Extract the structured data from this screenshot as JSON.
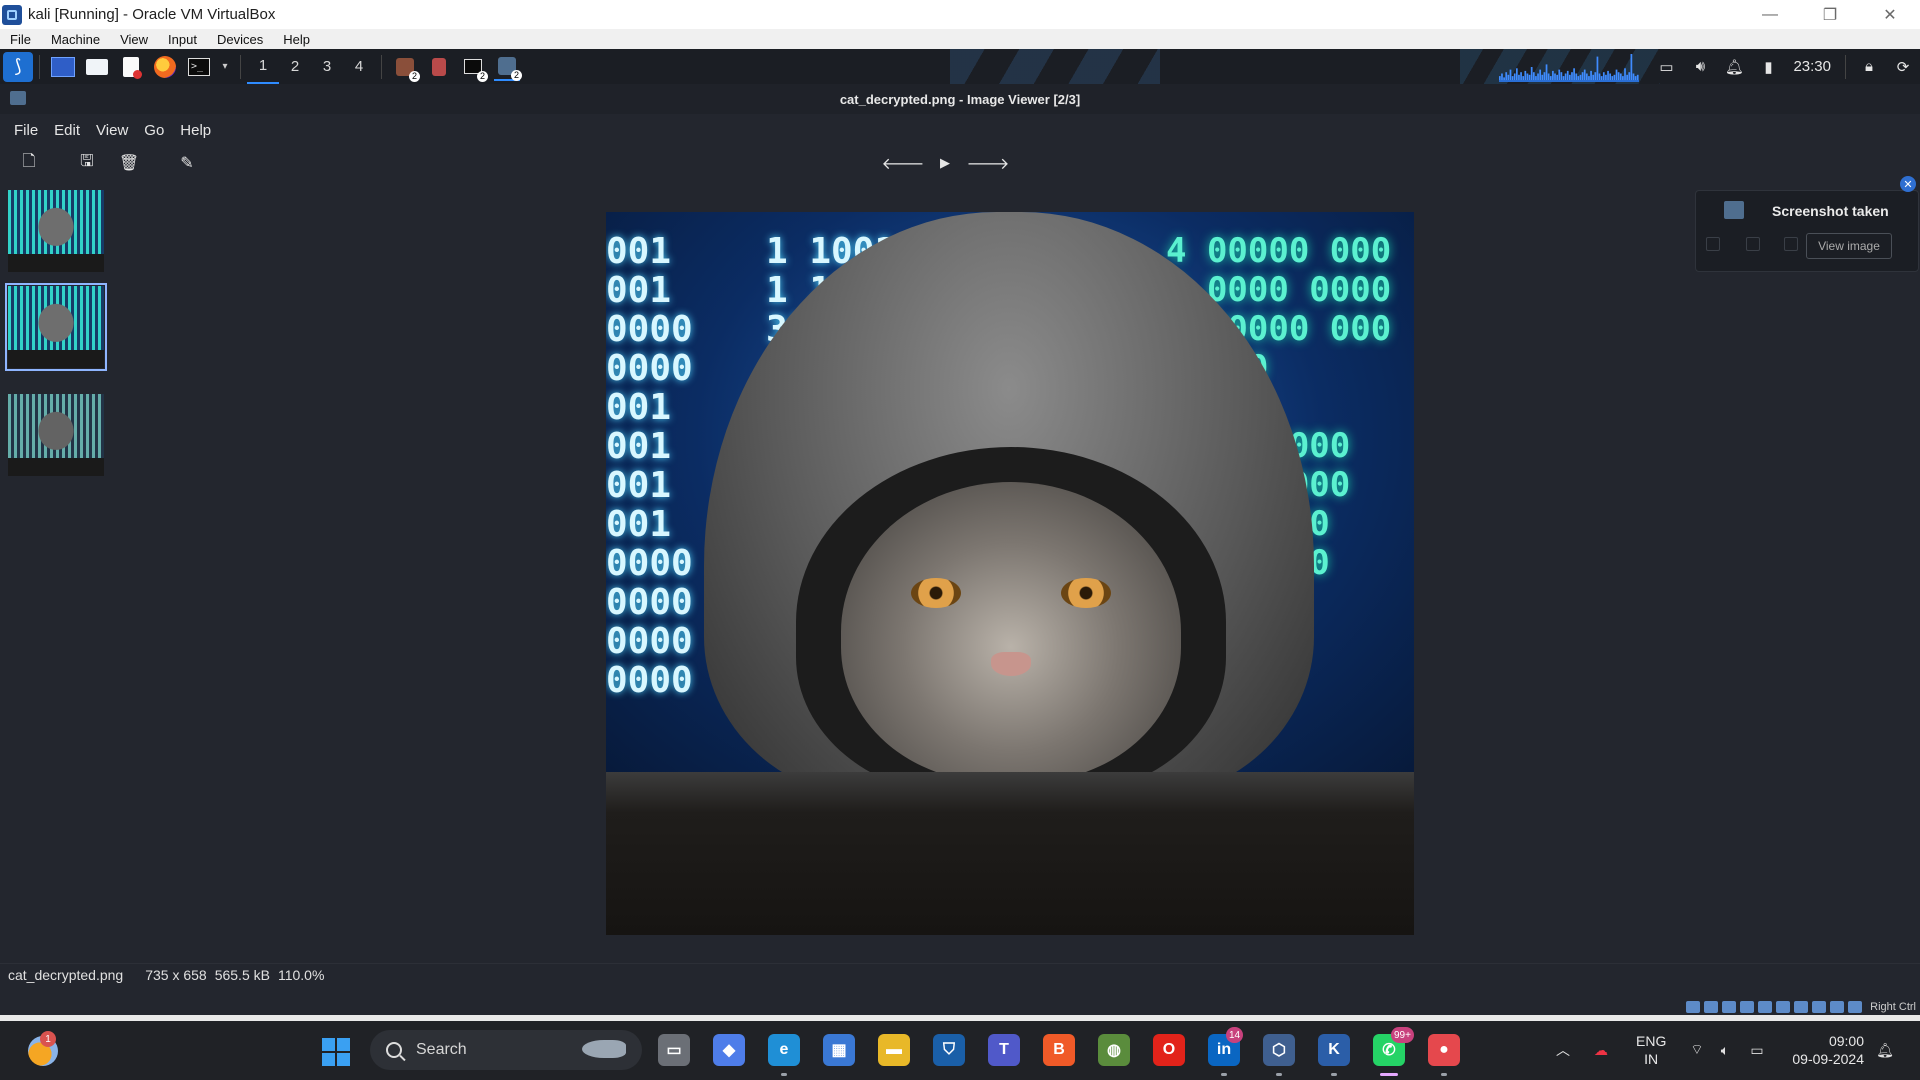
{
  "host_window": {
    "title": "kali [Running] - Oracle VM VirtualBox",
    "controls": {
      "minimize": "—",
      "restore": "❐",
      "close": "✕"
    }
  },
  "vbox_menu": [
    "File",
    "Machine",
    "View",
    "Input",
    "Devices",
    "Help"
  ],
  "kali_panel": {
    "workspaces": [
      "1",
      "2",
      "3",
      "4"
    ],
    "active_workspace": "1",
    "task_badges": [
      "2",
      "2",
      "2"
    ],
    "clock": "23:30",
    "terminal_glyph": ">_",
    "cpu_graph": [
      3,
      5,
      2,
      6,
      4,
      8,
      3,
      5,
      9,
      4,
      6,
      3,
      7,
      5,
      4,
      10,
      6,
      3,
      5,
      8,
      4,
      6,
      12,
      5,
      3,
      7,
      5,
      4,
      8,
      6,
      3,
      5,
      7,
      4,
      6,
      9,
      5,
      3,
      4,
      6,
      8,
      5,
      3,
      7,
      4,
      6,
      18,
      5,
      3,
      6,
      4,
      7,
      5,
      3,
      4,
      8,
      6,
      5,
      3,
      9,
      4,
      6,
      20,
      5,
      3,
      4
    ]
  },
  "viewer": {
    "title": "cat_decrypted.png - Image Viewer [2/3]",
    "menu": [
      "File",
      "Edit",
      "View",
      "Go",
      "Help"
    ],
    "toolbar_icons": [
      "open-icon",
      "save-icon",
      "delete-icon",
      "edit-icon"
    ],
    "nav_icons": {
      "prev": "🡐",
      "play": "▶",
      "next": "🡒"
    },
    "thumbnails": [
      {
        "name": "image-1",
        "selected": false
      },
      {
        "name": "image-2",
        "selected": true
      },
      {
        "name": "image-3",
        "selected": false
      }
    ],
    "image_code_left": "001\n001\n0000\n0000\n001\n001\n001\n001\n0000\n0000\n0000\n0000",
    "image_code_mid": "1 1001\n1 10\n31\n1\n1",
    "image_code_right": "4 00000 000\n8 0000 0000\n1 00000 000\n00000\n00000\n00000 000\n0000 0000\n0000 000\n000 0000\n00 000\n00 00\n000",
    "status": {
      "filename": "cat_decrypted.png",
      "dimensions": "735 x 658",
      "size": "565.5 kB",
      "zoom": "110.0%"
    }
  },
  "notification": {
    "title": "Screenshot taken",
    "button": "View image"
  },
  "vbox_status": {
    "hostkey": "Right Ctrl"
  },
  "taskbar": {
    "weather_badge": "1",
    "search_label": "Search",
    "apps": [
      {
        "name": "task-view",
        "color": "#6b6f76",
        "glyph": "▭"
      },
      {
        "name": "copilot",
        "color": "#4e7de9",
        "glyph": "◆"
      },
      {
        "name": "edge",
        "color": "#1f8fd6",
        "glyph": "e"
      },
      {
        "name": "store",
        "color": "#3a78d4",
        "glyph": "▦"
      },
      {
        "name": "file-explorer",
        "color": "#e8b828",
        "glyph": "▬"
      },
      {
        "name": "defender",
        "color": "#1a5fa8",
        "glyph": "⛉"
      },
      {
        "name": "teams",
        "color": "#5059c9",
        "glyph": "T"
      },
      {
        "name": "brave",
        "color": "#f05a28",
        "glyph": "B"
      },
      {
        "name": "maps-app",
        "color": "#5a8c3c",
        "glyph": "◍"
      },
      {
        "name": "opera",
        "color": "#e2231a",
        "glyph": "O"
      },
      {
        "name": "linkedin",
        "color": "#0a66c2",
        "glyph": "in"
      },
      {
        "name": "virtualbox",
        "color": "#3f5f8f",
        "glyph": "⬡"
      },
      {
        "name": "kali-vm",
        "color": "#2b5ea8",
        "glyph": "K"
      },
      {
        "name": "whatsapp",
        "color": "#25d366",
        "glyph": "✆"
      },
      {
        "name": "recorder",
        "color": "#e5484d",
        "glyph": "●"
      }
    ],
    "badges": {
      "linkedin": "14",
      "whatsapp": "99+"
    },
    "lang_line1": "ENG",
    "lang_line2": "IN",
    "time": "09:00",
    "date": "09-09-2024"
  }
}
